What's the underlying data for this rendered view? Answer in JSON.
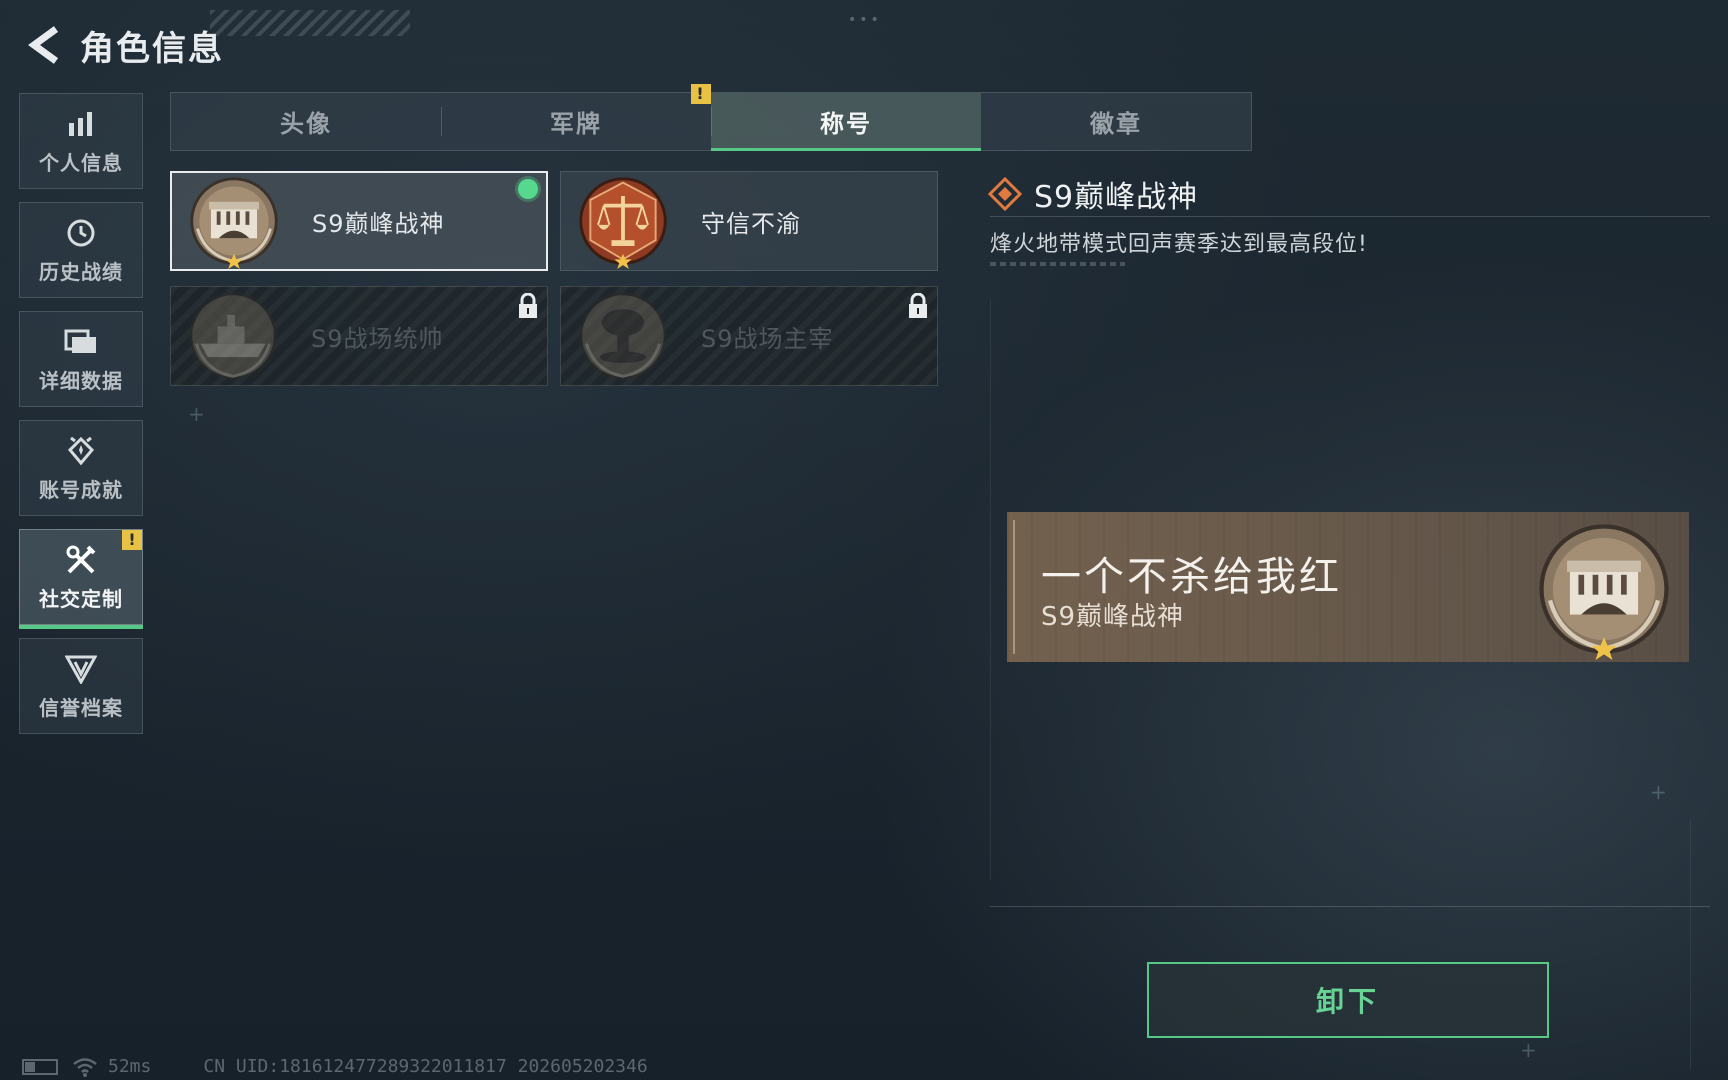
{
  "header": {
    "title": "角色信息"
  },
  "sidebar": {
    "items": [
      {
        "label": "个人信息",
        "icon": "bar-chart-icon",
        "active": false
      },
      {
        "label": "历史战绩",
        "icon": "clock-history-icon",
        "active": false
      },
      {
        "label": "详细数据",
        "icon": "folder-icon",
        "active": false
      },
      {
        "label": "账号成就",
        "icon": "achievement-icon",
        "active": false
      },
      {
        "label": "社交定制",
        "icon": "tools-icon",
        "active": true,
        "alert": "!"
      },
      {
        "label": "信誉档案",
        "icon": "shield-wing-icon",
        "active": false
      }
    ]
  },
  "tabs": [
    {
      "label": "头像",
      "active": false
    },
    {
      "label": "军牌",
      "active": false,
      "alert": "!"
    },
    {
      "label": "称号",
      "active": true
    },
    {
      "label": "徽章",
      "active": false
    }
  ],
  "titles": [
    {
      "label": "S9巅峰战神",
      "emblem": "fortress-emblem-icon",
      "state": "equipped"
    },
    {
      "label": "守信不渝",
      "emblem": "scales-emblem-icon",
      "state": "owned"
    },
    {
      "label": "S9战场统帅",
      "emblem": "warship-emblem-icon",
      "state": "locked"
    },
    {
      "label": "S9战场主宰",
      "emblem": "mushroom-cloud-emblem-icon",
      "state": "locked"
    }
  ],
  "detail": {
    "title": "S9巅峰战神",
    "description": "烽火地带模式回声赛季达到最高段位!"
  },
  "preview": {
    "player_name": "一个不杀给我红",
    "title": "S9巅峰战神"
  },
  "actions": {
    "unequip_label": "卸下"
  },
  "status": {
    "ping": "52ms",
    "uid": "CN UID:18161247728932201​1817 202605202346"
  },
  "colors": {
    "accent_green": "#56c986",
    "alert_yellow": "#e8c244",
    "banner_bronze": "#7a6650"
  }
}
